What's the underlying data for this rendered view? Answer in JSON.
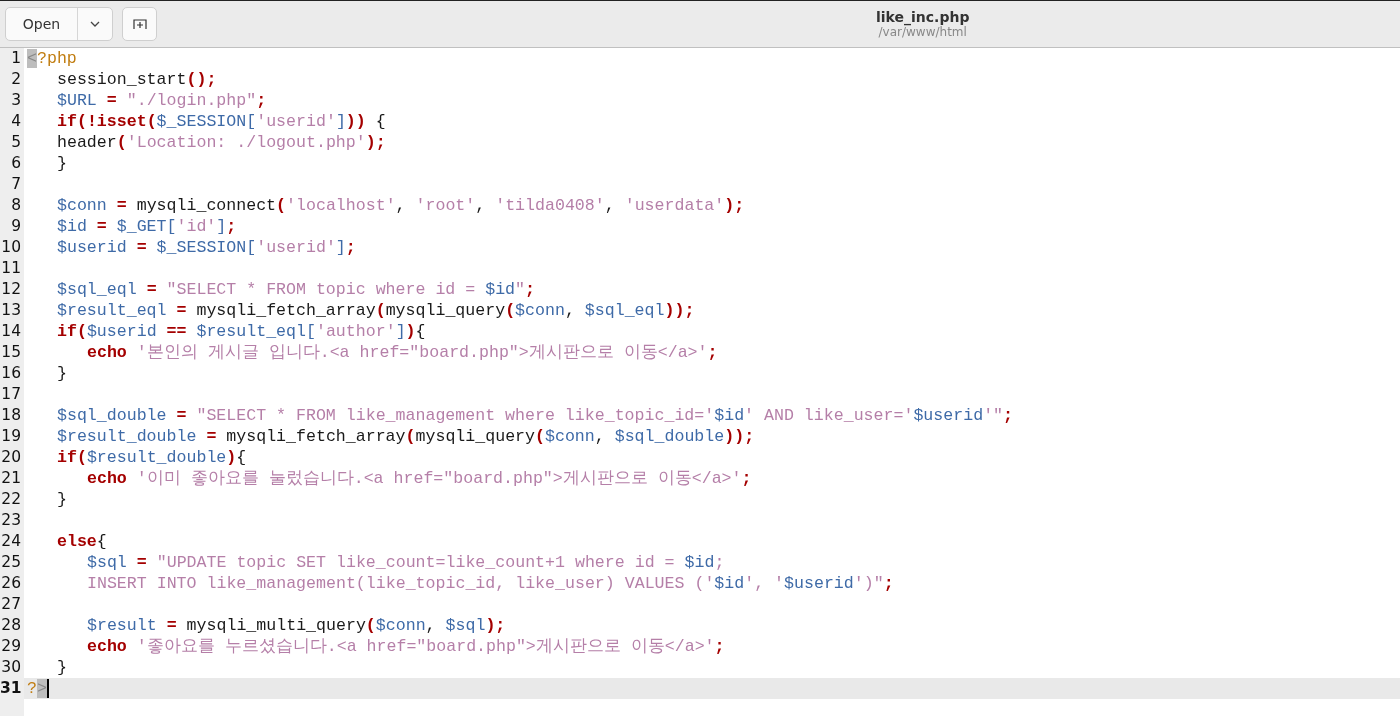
{
  "header": {
    "open_button": "Open",
    "title": "like_inc.php",
    "subtitle": "/var/www/html"
  },
  "editor": {
    "lines": [
      {
        "number": "1",
        "current": false,
        "tokens": [
          {
            "kind": "match",
            "text": "<"
          },
          {
            "kind": "tag",
            "text": "?php"
          }
        ],
        "children": [
          {
            "number": "2",
            "current": false,
            "tokens": [
              {
                "kind": "plain",
                "text": "session_start"
              },
              {
                "kind": "paren",
                "text": "()"
              },
              {
                "kind": "op",
                "text": ";"
              }
            ]
          },
          {
            "number": "3",
            "current": false,
            "tokens": [
              {
                "kind": "var",
                "text": "$URL"
              },
              {
                "kind": "op",
                "text": " = "
              },
              {
                "kind": "str",
                "text": "\"./login.php\""
              },
              {
                "kind": "op",
                "text": ";"
              }
            ]
          },
          {
            "number": "4",
            "current": false,
            "tokens": [
              {
                "kind": "kw",
                "text": "if"
              },
              {
                "kind": "paren",
                "text": "("
              },
              {
                "kind": "kw",
                "text": "!isset"
              },
              {
                "kind": "paren",
                "text": "("
              },
              {
                "kind": "var",
                "text": "$_SESSION["
              },
              {
                "kind": "str",
                "text": "'userid'"
              },
              {
                "kind": "var",
                "text": "]"
              },
              {
                "kind": "paren",
                "text": "))"
              },
              {
                "kind": "plain",
                "text": " {"
              }
            ]
          },
          {
            "number": "5",
            "current": false,
            "tokens": [
              {
                "kind": "plain",
                "text": "header"
              },
              {
                "kind": "paren",
                "text": "("
              },
              {
                "kind": "str",
                "text": "'Location: ./logout.php'"
              },
              {
                "kind": "paren",
                "text": ")"
              },
              {
                "kind": "op",
                "text": ";"
              }
            ]
          },
          {
            "number": "6",
            "current": false,
            "tokens": [
              {
                "kind": "plain",
                "text": "}"
              }
            ]
          },
          {
            "number": "7",
            "current": false
          },
          {
            "number": "8",
            "current": false,
            "tokens": [
              {
                "kind": "var",
                "text": "$conn"
              },
              {
                "kind": "op",
                "text": " = "
              },
              {
                "kind": "plain",
                "text": "mysqli_connect"
              },
              {
                "kind": "paren",
                "text": "("
              },
              {
                "kind": "str",
                "text": "'localhost'"
              },
              {
                "kind": "plain",
                "text": ", "
              },
              {
                "kind": "str",
                "text": "'root'"
              },
              {
                "kind": "plain",
                "text": ", "
              },
              {
                "kind": "str",
                "text": "'tilda0408'"
              },
              {
                "kind": "plain",
                "text": ", "
              },
              {
                "kind": "str",
                "text": "'userdata'"
              },
              {
                "kind": "paren",
                "text": ")"
              },
              {
                "kind": "op",
                "text": ";"
              }
            ]
          },
          {
            "number": "9",
            "current": false,
            "tokens": [
              {
                "kind": "var",
                "text": "$id"
              },
              {
                "kind": "op",
                "text": " = "
              },
              {
                "kind": "var",
                "text": "$_GET["
              },
              {
                "kind": "str",
                "text": "'id'"
              },
              {
                "kind": "var",
                "text": "]"
              },
              {
                "kind": "op",
                "text": ";"
              }
            ]
          },
          {
            "number": "10",
            "current": false,
            "tokens": [
              {
                "kind": "var",
                "text": "$userid"
              },
              {
                "kind": "op",
                "text": " = "
              },
              {
                "kind": "var",
                "text": "$_SESSION["
              },
              {
                "kind": "str",
                "text": "'userid'"
              },
              {
                "kind": "var",
                "text": "]"
              },
              {
                "kind": "op",
                "text": ";"
              }
            ]
          },
          {
            "number": "11",
            "current": false
          },
          {
            "number": "12",
            "current": false,
            "tokens": [
              {
                "kind": "var",
                "text": "$sql_eql"
              },
              {
                "kind": "op",
                "text": " = "
              },
              {
                "kind": "str",
                "text": "\"SELECT * FROM topic where id = "
              },
              {
                "kind": "var",
                "text": "$id"
              },
              {
                "kind": "str",
                "text": "\""
              },
              {
                "kind": "op",
                "text": ";"
              }
            ]
          },
          {
            "number": "13",
            "current": false,
            "tokens": [
              {
                "kind": "var",
                "text": "$result_eql"
              },
              {
                "kind": "op",
                "text": " = "
              },
              {
                "kind": "plain",
                "text": "mysqli_fetch_array"
              },
              {
                "kind": "paren",
                "text": "("
              },
              {
                "kind": "plain",
                "text": "mysqli_query"
              },
              {
                "kind": "paren",
                "text": "("
              },
              {
                "kind": "var",
                "text": "$conn"
              },
              {
                "kind": "plain",
                "text": ", "
              },
              {
                "kind": "var",
                "text": "$sql_eql"
              },
              {
                "kind": "paren",
                "text": "))"
              },
              {
                "kind": "op",
                "text": ";"
              }
            ]
          },
          {
            "number": "14",
            "current": false,
            "tokens": [
              {
                "kind": "kw",
                "text": "if"
              },
              {
                "kind": "paren",
                "text": "("
              },
              {
                "kind": "var",
                "text": "$userid"
              },
              {
                "kind": "op",
                "text": " == "
              },
              {
                "kind": "var",
                "text": "$result_eql["
              },
              {
                "kind": "str",
                "text": "'author'"
              },
              {
                "kind": "var",
                "text": "]"
              },
              {
                "kind": "paren",
                "text": ")"
              },
              {
                "kind": "plain",
                "text": "{"
              }
            ],
            "children": [
              {
                "number": "15",
                "current": false,
                "tokens": [
                  {
                    "kind": "kw",
                    "text": "echo"
                  },
                  {
                    "kind": "str",
                    "text": " '본인의 게시글 입니다.<a href=\"board.php\">게시판으로 이동</a>'"
                  },
                  {
                    "kind": "op",
                    "text": ";"
                  }
                ]
              }
            ]
          },
          {
            "number": "16",
            "current": false,
            "tokens": [
              {
                "kind": "plain",
                "text": "}"
              }
            ]
          },
          {
            "number": "17",
            "current": false
          },
          {
            "number": "18",
            "current": false,
            "tokens": [
              {
                "kind": "var",
                "text": "$sql_double"
              },
              {
                "kind": "op",
                "text": " = "
              },
              {
                "kind": "str",
                "text": "\"SELECT * FROM like_management where like_topic_id='"
              },
              {
                "kind": "var",
                "text": "$id"
              },
              {
                "kind": "str",
                "text": "' AND like_user='"
              },
              {
                "kind": "var",
                "text": "$userid"
              },
              {
                "kind": "str",
                "text": "'\""
              },
              {
                "kind": "op",
                "text": ";"
              }
            ]
          },
          {
            "number": "19",
            "current": false,
            "tokens": [
              {
                "kind": "var",
                "text": "$result_double"
              },
              {
                "kind": "op",
                "text": " = "
              },
              {
                "kind": "plain",
                "text": "mysqli_fetch_array"
              },
              {
                "kind": "paren",
                "text": "("
              },
              {
                "kind": "plain",
                "text": "mysqli_query"
              },
              {
                "kind": "paren",
                "text": "("
              },
              {
                "kind": "var",
                "text": "$conn"
              },
              {
                "kind": "plain",
                "text": ", "
              },
              {
                "kind": "var",
                "text": "$sql_double"
              },
              {
                "kind": "paren",
                "text": "))"
              },
              {
                "kind": "op",
                "text": ";"
              }
            ]
          },
          {
            "number": "20",
            "current": false,
            "tokens": [
              {
                "kind": "kw",
                "text": "if"
              },
              {
                "kind": "paren",
                "text": "("
              },
              {
                "kind": "var",
                "text": "$result_double"
              },
              {
                "kind": "paren",
                "text": ")"
              },
              {
                "kind": "plain",
                "text": "{"
              }
            ],
            "children": [
              {
                "number": "21",
                "current": false,
                "tokens": [
                  {
                    "kind": "kw",
                    "text": "echo"
                  },
                  {
                    "kind": "str",
                    "text": " '이미 좋아요를 눌렀습니다.<a href=\"board.php\">게시판으로 이동</a>'"
                  },
                  {
                    "kind": "op",
                    "text": ";"
                  }
                ]
              }
            ]
          },
          {
            "number": "22",
            "current": false,
            "tokens": [
              {
                "kind": "plain",
                "text": "}"
              }
            ]
          },
          {
            "number": "23",
            "current": false
          },
          {
            "number": "24",
            "current": false,
            "tokens": [
              {
                "kind": "kw",
                "text": "else"
              },
              {
                "kind": "plain",
                "text": "{"
              }
            ],
            "children": [
              {
                "number": "25",
                "current": false,
                "tokens": [
                  {
                    "kind": "var",
                    "text": "$sql"
                  },
                  {
                    "kind": "op",
                    "text": " = "
                  },
                  {
                    "kind": "str",
                    "text": "\"UPDATE topic SET like_count=like_count+1 where id = "
                  },
                  {
                    "kind": "var",
                    "text": "$id"
                  },
                  {
                    "kind": "str",
                    "text": ";"
                  }
                ]
              },
              {
                "number": "26",
                "current": false,
                "tokens": [
                  {
                    "kind": "str",
                    "text": "INSERT INTO like_management(like_topic_id, like_user) VALUES ('"
                  },
                  {
                    "kind": "var",
                    "text": "$id"
                  },
                  {
                    "kind": "str",
                    "text": "', '"
                  },
                  {
                    "kind": "var",
                    "text": "$userid"
                  },
                  {
                    "kind": "str",
                    "text": "')\""
                  },
                  {
                    "kind": "op",
                    "text": ";"
                  }
                ]
              },
              {
                "number": "27",
                "current": false
              },
              {
                "number": "28",
                "current": false,
                "tokens": [
                  {
                    "kind": "var",
                    "text": "$result"
                  },
                  {
                    "kind": "op",
                    "text": " = "
                  },
                  {
                    "kind": "plain",
                    "text": "mysqli_multi_query"
                  },
                  {
                    "kind": "paren",
                    "text": "("
                  },
                  {
                    "kind": "var",
                    "text": "$conn"
                  },
                  {
                    "kind": "plain",
                    "text": ", "
                  },
                  {
                    "kind": "var",
                    "text": "$sql"
                  },
                  {
                    "kind": "paren",
                    "text": ")"
                  },
                  {
                    "kind": "op",
                    "text": ";"
                  }
                ]
              },
              {
                "number": "29",
                "current": false,
                "tokens": [
                  {
                    "kind": "kw",
                    "text": "echo"
                  },
                  {
                    "kind": "str",
                    "text": " '좋아요를 누르셨습니다.<a href=\"board.php\">게시판으로 이동</a>'"
                  },
                  {
                    "kind": "op",
                    "text": ";"
                  }
                ]
              }
            ]
          },
          {
            "number": "30",
            "current": false,
            "tokens": [
              {
                "kind": "plain",
                "text": "}"
              }
            ]
          }
        ]
      },
      {
        "number": "31",
        "current": true,
        "tokens": [
          {
            "kind": "tag",
            "text": "?"
          },
          {
            "kind": "match",
            "text": ">"
          }
        ]
      }
    ]
  }
}
